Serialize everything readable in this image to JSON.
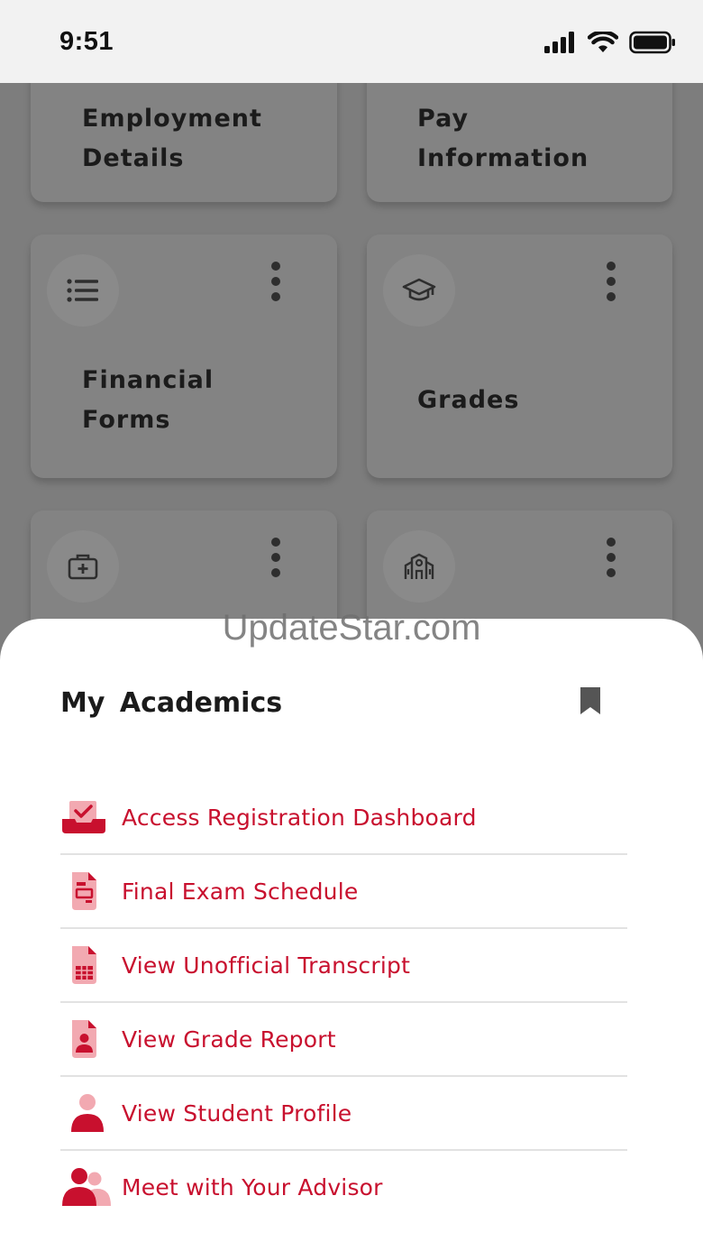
{
  "status_bar": {
    "time": "9:51"
  },
  "tiles": [
    {
      "title": "Employment\nDetails",
      "icon": "none"
    },
    {
      "title": "Pay\nInformation",
      "icon": "none"
    },
    {
      "title": "Financial\nForms",
      "icon": "list-icon"
    },
    {
      "title": "Grades",
      "icon": "graduation-cap-icon"
    },
    {
      "title": "",
      "icon": "medical-kit-icon"
    },
    {
      "title": "",
      "icon": "campus-building-icon"
    }
  ],
  "watermark": "UpdateStar.com",
  "sheet": {
    "title": "My  Academics",
    "items": [
      {
        "label": "Access Registration Dashboard",
        "icon": "registration-icon"
      },
      {
        "label": "Final Exam Schedule",
        "icon": "exam-schedule-icon"
      },
      {
        "label": "View Unofficial Transcript",
        "icon": "transcript-icon"
      },
      {
        "label": "View Grade Report",
        "icon": "grade-report-icon"
      },
      {
        "label": "View Student Profile",
        "icon": "student-profile-icon"
      },
      {
        "label": "Meet with Your Advisor",
        "icon": "advisor-icon"
      }
    ]
  },
  "colors": {
    "accent": "#c8102e",
    "accent_light": "#f2a9b1",
    "overlay": "#7d7d7d"
  }
}
